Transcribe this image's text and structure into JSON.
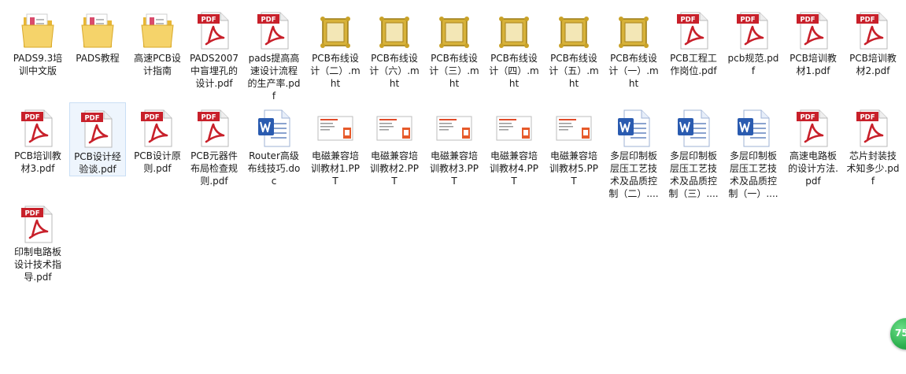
{
  "files": [
    {
      "label": "PADS9.3培训中文版",
      "icon": "folder-icon"
    },
    {
      "label": "PADS教程",
      "icon": "folder-icon"
    },
    {
      "label": "高速PCB设计指南",
      "icon": "folder-icon"
    },
    {
      "label": "PADS2007中盲埋孔的设计.pdf",
      "icon": "pdf-icon"
    },
    {
      "label": "pads提高高速设计流程的生产率.pdf",
      "icon": "pdf-icon"
    },
    {
      "label": "PCB布线设计（二）.mht",
      "icon": "mht-icon"
    },
    {
      "label": "PCB布线设计（六）.mht",
      "icon": "mht-icon"
    },
    {
      "label": "PCB布线设计（三）.mht",
      "icon": "mht-icon"
    },
    {
      "label": "PCB布线设计（四）.mht",
      "icon": "mht-icon"
    },
    {
      "label": "PCB布线设计（五）.mht",
      "icon": "mht-icon"
    },
    {
      "label": "PCB布线设计（一）.mht",
      "icon": "mht-icon"
    },
    {
      "label": "PCB工程工作岗位.pdf",
      "icon": "pdf-icon"
    },
    {
      "label": "pcb规范.pdf",
      "icon": "pdf-icon"
    },
    {
      "label": "PCB培训教材1.pdf",
      "icon": "pdf-icon"
    },
    {
      "label": "PCB培训教材2.pdf",
      "icon": "pdf-icon"
    },
    {
      "label": "PCB培训教材3.pdf",
      "icon": "pdf-icon"
    },
    {
      "label": "PCB设计经验谈.pdf",
      "icon": "pdf-icon",
      "selected": true
    },
    {
      "label": "PCB设计原则.pdf",
      "icon": "pdf-icon"
    },
    {
      "label": "PCB元器件布局检查规则.pdf",
      "icon": "pdf-icon"
    },
    {
      "label": "Router高级布线技巧.doc",
      "icon": "word-icon"
    },
    {
      "label": "电磁兼容培训教材1.PPT",
      "icon": "ppt-icon"
    },
    {
      "label": "电磁兼容培训教材2.PPT",
      "icon": "ppt-icon"
    },
    {
      "label": "电磁兼容培训教材3.PPT",
      "icon": "ppt-icon"
    },
    {
      "label": "电磁兼容培训教材4.PPT",
      "icon": "ppt-icon"
    },
    {
      "label": "电磁兼容培训教材5.PPT",
      "icon": "ppt-icon"
    },
    {
      "label": "多层印制板层压工艺技术及品质控制（二）....",
      "icon": "word-icon"
    },
    {
      "label": "多层印制板层压工艺技术及品质控制（三）....",
      "icon": "word-icon"
    },
    {
      "label": "多层印制板层压工艺技术及品质控制（一）....",
      "icon": "word-icon"
    },
    {
      "label": "高速电路板的设计方法.pdf",
      "icon": "pdf-icon"
    },
    {
      "label": "芯片封装技术知多少.pdf",
      "icon": "pdf-icon"
    },
    {
      "label": "印制电路板设计技术指导.pdf",
      "icon": "pdf-icon"
    }
  ],
  "badge": {
    "text": "75"
  },
  "pdf_badge_text": "PDF",
  "colors": {
    "selection_bg": "#eef5fd",
    "selection_border": "#c9dff5",
    "pdf_red": "#c8202a",
    "word_blue": "#2a5bb0",
    "folder_yellow": "#f1c84b",
    "mht_gold": "#c9a227"
  }
}
